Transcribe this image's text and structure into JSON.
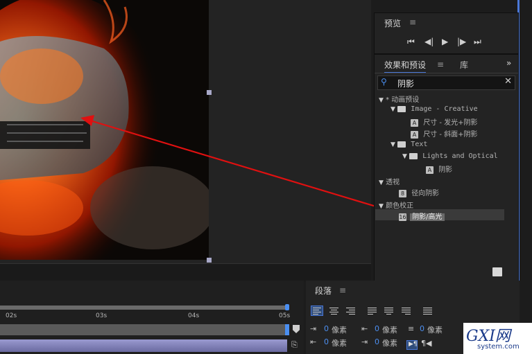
{
  "preview_panel": {
    "title": "预览"
  },
  "effects_panel": {
    "tab_active": "效果和预设",
    "tab_library": "库",
    "search_value": "阴影",
    "tree": [
      {
        "label": "* 动画预设"
      },
      {
        "label": "Image - Creative"
      },
      {
        "label": "尺寸 - 发光+阴影"
      },
      {
        "label": "尺寸 - 斜面+阴影"
      },
      {
        "label": "Text"
      },
      {
        "label": "Lights and Optical"
      },
      {
        "label": "阴影"
      },
      {
        "label": "透视"
      },
      {
        "label": "径向阴影"
      },
      {
        "label": "颜色校正"
      },
      {
        "label": "阴影/高光"
      }
    ],
    "selected_fx_badge": "16"
  },
  "timeline": {
    "ruler": [
      "02s",
      "03s",
      "04s",
      "05s"
    ]
  },
  "paragraph_panel": {
    "title": "段落",
    "fields": [
      {
        "value": "0",
        "unit": "像素"
      },
      {
        "value": "0",
        "unit": "像素"
      },
      {
        "value": "0",
        "unit": "像素"
      },
      {
        "value": "0",
        "unit": "像素"
      },
      {
        "value": "0",
        "unit": "像素"
      }
    ]
  },
  "watermark": {
    "brand": "GXI网",
    "site": "system.com"
  },
  "colors": {
    "accent_blue": "#4a78d8",
    "annotation_red": "#e01010",
    "fire_orange": "#ff6a1a"
  }
}
